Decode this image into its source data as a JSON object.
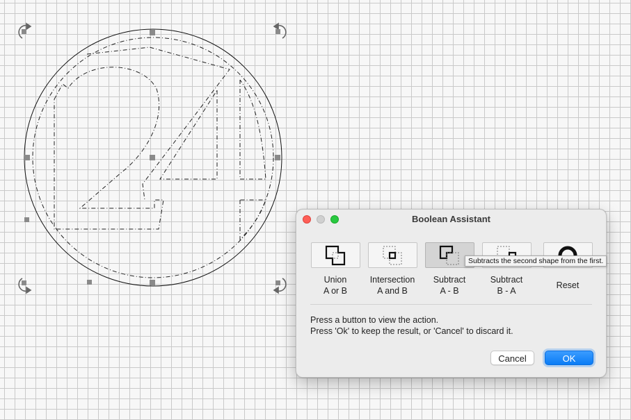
{
  "dialog": {
    "title": "Boolean Assistant",
    "operations": [
      {
        "line1": "Union",
        "line2": "A or B",
        "icon": "union-icon",
        "pressed": false
      },
      {
        "line1": "Intersection",
        "line2": "A and B",
        "icon": "intersection-icon",
        "pressed": false
      },
      {
        "line1": "Subtract",
        "line2": "A - B",
        "icon": "subtract-a-b-icon",
        "pressed": true
      },
      {
        "line1": "Subtract",
        "line2": "B - A",
        "icon": "subtract-b-a-icon",
        "pressed": false
      },
      {
        "line1": "Reset",
        "line2": "",
        "icon": "reset-icon",
        "pressed": false
      }
    ],
    "tooltip": "Subtracts the second shape from the first.",
    "message_line1": "Press a button to view the action.",
    "message_line2": "Press 'Ok' to keep the result, or 'Cancel' to discard it.",
    "cancel_label": "Cancel",
    "ok_label": "OK",
    "accent_color": "#0a7cf5"
  },
  "canvas": {
    "grid_color": "#c9c9c9",
    "background_color": "#f7f7f7",
    "shapes": [
      "circle",
      "digit-outline-2",
      "digit-outline-4"
    ],
    "selection_handles": 8,
    "rotation_handles": 4
  }
}
